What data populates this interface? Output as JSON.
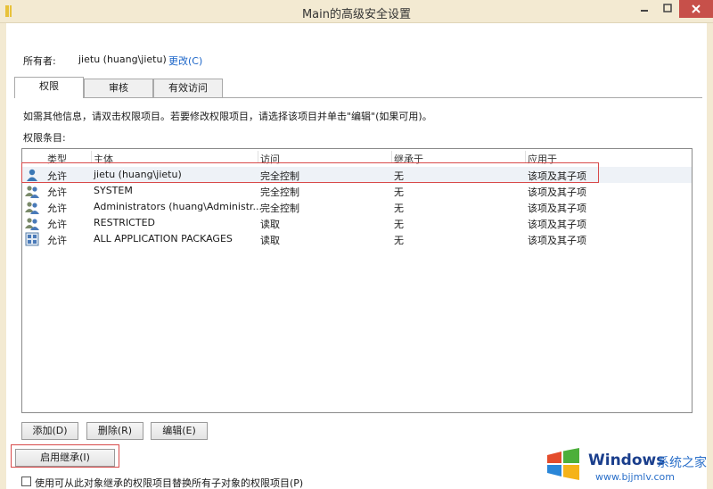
{
  "window": {
    "title": "Main的高级安全设置"
  },
  "owner": {
    "label": "所有者:",
    "value": "jietu (huang\\jietu)",
    "change_link": "更改(C)"
  },
  "tabs": [
    {
      "label": "权限",
      "active": true
    },
    {
      "label": "审核",
      "active": false
    },
    {
      "label": "有效访问",
      "active": false
    }
  ],
  "instructions": "如需其他信息，请双击权限项目。若要修改权限项目，请选择该项目并单击\"编辑\"(如果可用)。",
  "entries_label": "权限条目:",
  "columns": [
    "类型",
    "主体",
    "访问",
    "继承于",
    "应用于"
  ],
  "rows": [
    {
      "type": "允许",
      "principal": "jietu (huang\\jietu)",
      "access": "完全控制",
      "inherited": "无",
      "applies": "该项及其子项",
      "icon": "single-user-icon"
    },
    {
      "type": "允许",
      "principal": "SYSTEM",
      "access": "完全控制",
      "inherited": "无",
      "applies": "该项及其子项",
      "icon": "user-group-icon"
    },
    {
      "type": "允许",
      "principal": "Administrators (huang\\Administr...",
      "access": "完全控制",
      "inherited": "无",
      "applies": "该项及其子项",
      "icon": "user-group-icon"
    },
    {
      "type": "允许",
      "principal": "RESTRICTED",
      "access": "读取",
      "inherited": "无",
      "applies": "该项及其子项",
      "icon": "user-group-icon"
    },
    {
      "type": "允许",
      "principal": "ALL APPLICATION PACKAGES",
      "access": "读取",
      "inherited": "无",
      "applies": "该项及其子项",
      "icon": "app-packages-icon"
    }
  ],
  "buttons": {
    "add": "添加(D)",
    "remove": "删除(R)",
    "edit": "编辑(E)",
    "enable_inheritance": "启用继承(I)"
  },
  "replace_checkbox": {
    "label": "使用可从此对象继承的权限项目替换所有子对象的权限项目(P)",
    "checked": false
  },
  "watermark": {
    "brand": "Windows",
    "cn": "系统之家",
    "url": "www.bjjmlv.com"
  },
  "colors": {
    "title_bar": "#f3ead2",
    "close_button": "#c7504a",
    "link": "#1a64c8",
    "highlight": "#d84a4a",
    "selected_row": "#eef2f7"
  }
}
